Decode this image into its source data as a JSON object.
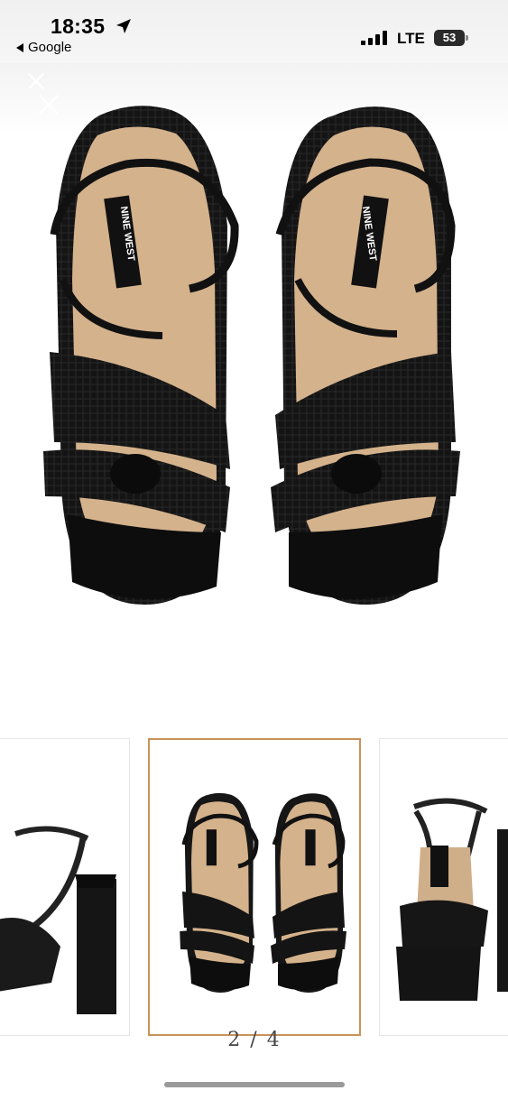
{
  "status_bar": {
    "time": "18:35",
    "back_app": "Google",
    "network": "LTE",
    "battery": "53"
  },
  "product": {
    "brand_label": "NINE WEST"
  },
  "gallery": {
    "page_indicator": "2 / 4",
    "selected_index": 1,
    "accent_color": "#c9925a"
  },
  "icons": {
    "location": "location-arrow-icon",
    "close": "close-icon",
    "signal": "signal-bars-icon",
    "battery": "battery-icon"
  }
}
